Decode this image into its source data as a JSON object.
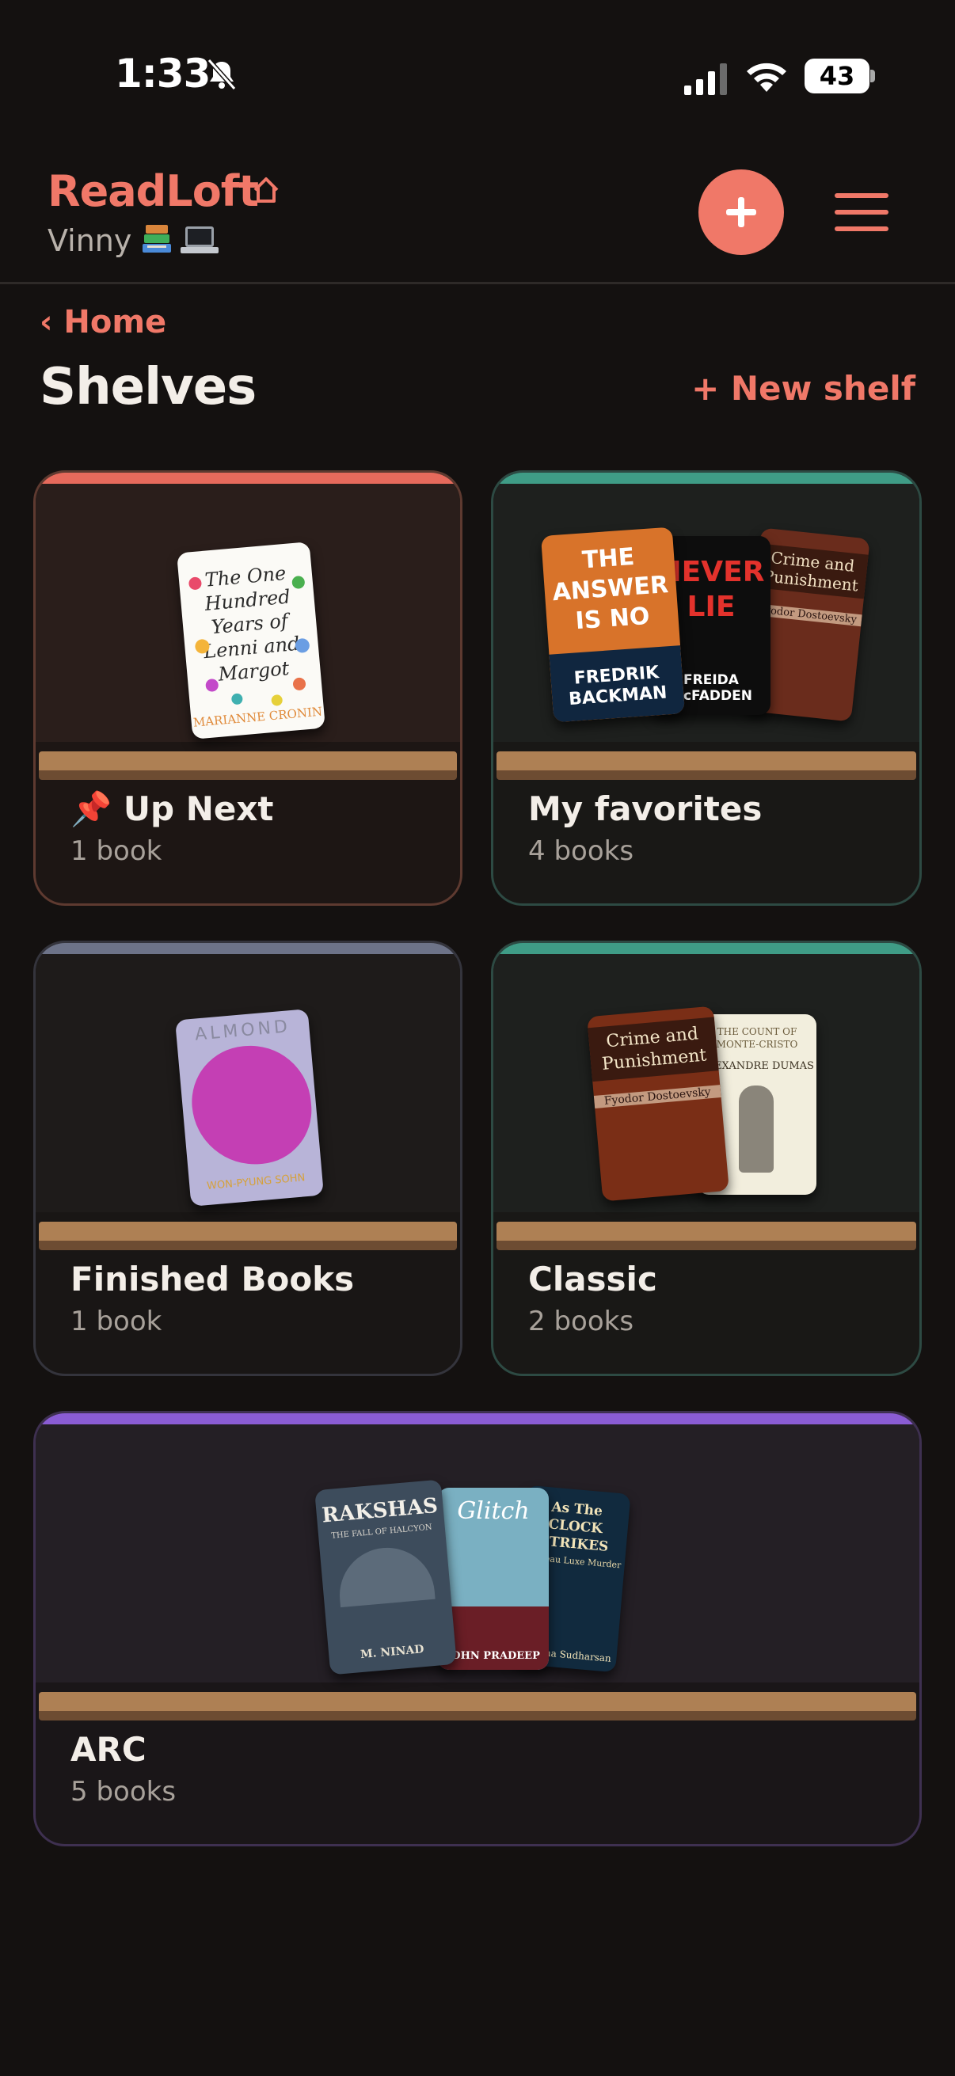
{
  "status": {
    "time": "1:33",
    "battery": "43"
  },
  "header": {
    "brand": "ReadLoft",
    "user": "Vinny",
    "colors": {
      "accent": "#f07868",
      "background": "#141110"
    }
  },
  "nav": {
    "back_label": "‹ Home",
    "page_title": "Shelves",
    "new_shelf_label": "+ New shelf"
  },
  "shelves": [
    {
      "title": "📌 Up Next",
      "count": "1 book",
      "accent": "#e66a5c",
      "covers": [
        {
          "title": "The One Hundred Years of Lenni and Margot",
          "author": "MARIANNE CRONIN"
        }
      ]
    },
    {
      "title": "My favorites",
      "count": "4 books",
      "accent": "#3f9c86",
      "covers": [
        {
          "title": "THE ANSWER IS NO",
          "author": "FREDRIK BACKMAN"
        },
        {
          "title": "NEVER LIE",
          "author": "FREIDA McFADDEN"
        },
        {
          "title": "Crime and Punishment",
          "author": "Fyodor Dostoevsky"
        }
      ]
    },
    {
      "title": "Finished Books",
      "count": "1 book",
      "accent": "#6d7388",
      "covers": [
        {
          "title": "ALMOND",
          "author": "WON-PYUNG SOHN"
        }
      ]
    },
    {
      "title": "Classic",
      "count": "2 books",
      "accent": "#3f9c86",
      "covers": [
        {
          "title": "Crime and Punishment",
          "author": "Fyodor Dostoevsky"
        },
        {
          "title": "THE COUNT OF MONTE-CRISTO",
          "author": "ALEXANDRE DUMAS"
        }
      ]
    },
    {
      "title": "ARC",
      "count": "5 books",
      "accent": "#8a5cd4",
      "covers": [
        {
          "title": "RAKSHAS",
          "subtitle": "THE FALL OF HALCYON",
          "author": "M. NINAD"
        },
        {
          "title": "Glitch",
          "author": "JOHN PRADEEP"
        },
        {
          "title": "As The CLOCK STRIKES",
          "subtitle": "Chateau Luxe Murder",
          "author": "Bhooma Sudharsan"
        }
      ]
    }
  ]
}
